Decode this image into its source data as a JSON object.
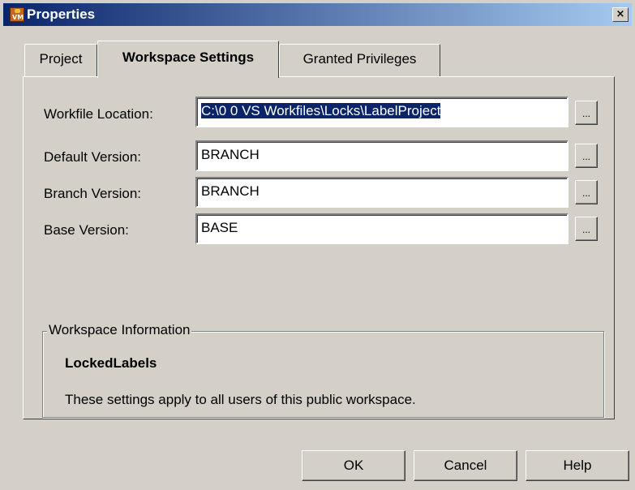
{
  "window": {
    "title": "Properties",
    "close_glyph": "×",
    "icon": "vss-app-icon",
    "icon_text": "VM"
  },
  "tabs": [
    {
      "label": "Project",
      "active": false
    },
    {
      "label": "Workspace Settings",
      "active": true
    },
    {
      "label": "Granted Privileges",
      "active": false
    }
  ],
  "fields": {
    "workfile_location": {
      "label": "Workfile Location:",
      "value": "C:\\0 0 VS Workfiles\\Locks\\LabelProject"
    },
    "default_version": {
      "label": "Default Version:",
      "value": "BRANCH"
    },
    "branch_version": {
      "label": "Branch Version:",
      "value": "BRANCH"
    },
    "base_version": {
      "label": "Base Version:",
      "value": "BASE"
    }
  },
  "browse_label": "...",
  "workspace_info": {
    "legend": "Workspace Information",
    "name": "LockedLabels",
    "description": "These settings apply to all users of this public workspace."
  },
  "buttons": {
    "ok": "OK",
    "cancel": "Cancel",
    "help": "Help"
  },
  "colors": {
    "titlebar_start": "#0a246a",
    "titlebar_end": "#a6caf0",
    "face": "#d4d0c8",
    "selection": "#0a246a"
  }
}
